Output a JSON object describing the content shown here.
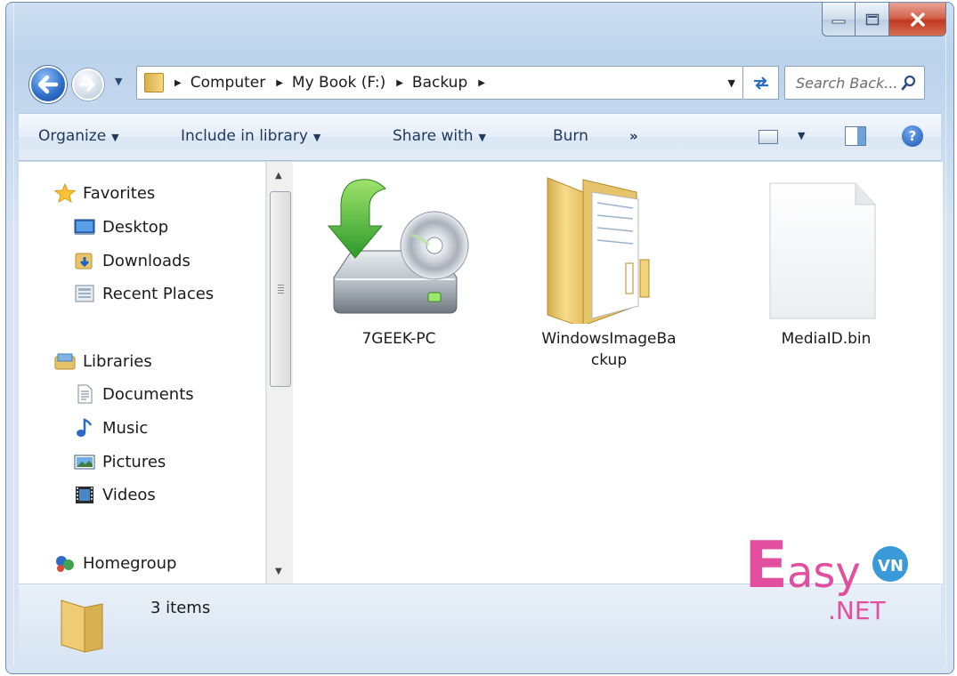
{
  "window": {
    "caption": {
      "minimize": "—",
      "maximize": "□",
      "close": "✕"
    }
  },
  "navigation": {
    "breadcrumbs": [
      "Computer",
      "My Book (F:)",
      "Backup"
    ],
    "search_placeholder": "Search Back...",
    "refresh_glyph": "⇆"
  },
  "toolbar": {
    "organize": "Organize",
    "include_in_library": "Include in library",
    "share_with": "Share with",
    "burn": "Burn",
    "more": "»"
  },
  "nav_pane": {
    "favorites": {
      "label": "Favorites",
      "items": [
        "Desktop",
        "Downloads",
        "Recent Places"
      ]
    },
    "libraries": {
      "label": "Libraries",
      "items": [
        "Documents",
        "Music",
        "Pictures",
        "Videos"
      ]
    },
    "homegroup": {
      "label": "Homegroup"
    }
  },
  "files": [
    {
      "name": "7GEEK-PC",
      "icon": "backup-drive-icon"
    },
    {
      "name_line1": "WindowsImageBa",
      "name_line2": "ckup",
      "icon": "folder-icon"
    },
    {
      "name": "MediaID.bin",
      "icon": "file-icon"
    }
  ],
  "status": {
    "item_count": "3 items"
  },
  "watermark": {
    "brand": "Easy",
    "badge": "VN",
    "suffix": ".NET"
  },
  "colors": {
    "accent": "#2c6cc6",
    "watermark_pink": "#e24ea0",
    "watermark_blue": "#3a9ad9"
  }
}
